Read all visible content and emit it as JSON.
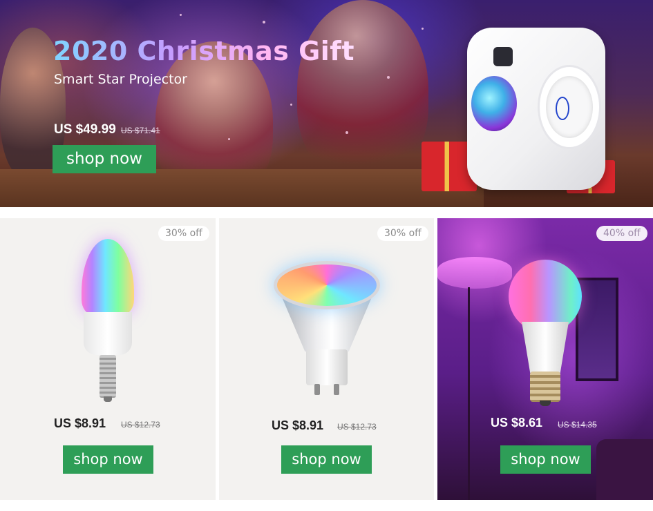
{
  "hero": {
    "title": "2020 Christmas Gift",
    "subtitle": "Smart Star Projector",
    "price": "US $49.99",
    "old_price": "US $71.41",
    "button_label": "shop now"
  },
  "products": [
    {
      "discount": "30% off",
      "price": "US $8.91",
      "old_price": "US $12.73",
      "button_label": "shop now",
      "icon": "candle-bulb-icon"
    },
    {
      "discount": "30% off",
      "price": "US $8.91",
      "old_price": "US $12.73",
      "button_label": "shop now",
      "icon": "gu10-bulb-icon"
    },
    {
      "discount": "40% off",
      "price": "US $8.61",
      "old_price": "US $14.35",
      "button_label": "shop now",
      "icon": "a19-bulb-icon"
    }
  ],
  "colors": {
    "button": "#2e9e57",
    "card_background": "#f3f2f0",
    "hero_title_gradient": [
      "#7fd4ff",
      "#c79cff",
      "#ffb5f2"
    ]
  }
}
